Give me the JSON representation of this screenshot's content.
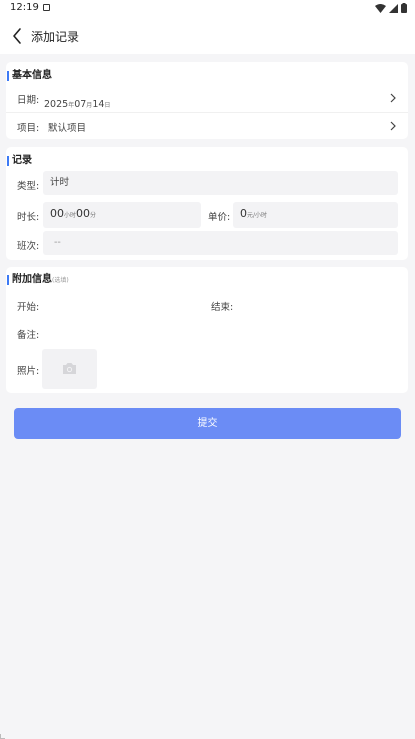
{
  "status_bar": {
    "time": "12:19"
  },
  "nav": {
    "title": "添加记录"
  },
  "basic_info": {
    "title": "基本信息",
    "date_label": "日期:",
    "date_year": "2025",
    "date_year_unit": "年",
    "date_month": "07",
    "date_month_unit": "月",
    "date_day": "14",
    "date_day_unit": "日",
    "project_label": "项目:",
    "project_value": "默认项目"
  },
  "record": {
    "title": "记录",
    "type_label": "类型:",
    "type_value": "计时",
    "duration_label": "时长:",
    "duration_hours": "00",
    "duration_hours_unit": "小时",
    "duration_minutes": "00",
    "duration_minutes_unit": "分",
    "price_label": "单价:",
    "price_value": "0",
    "price_unit": "元/小时",
    "shift_label": "班次:",
    "shift_value": "--"
  },
  "extra_info": {
    "title": "附加信息",
    "hint": "(选填)",
    "start_label": "开始:",
    "end_label": "结束:",
    "note_label": "备注:",
    "photo_label": "照片:"
  },
  "submit_label": "提交",
  "colors": {
    "accent": "#3d7af5",
    "button": "#6b8cf5",
    "background": "#f5f5f7"
  }
}
